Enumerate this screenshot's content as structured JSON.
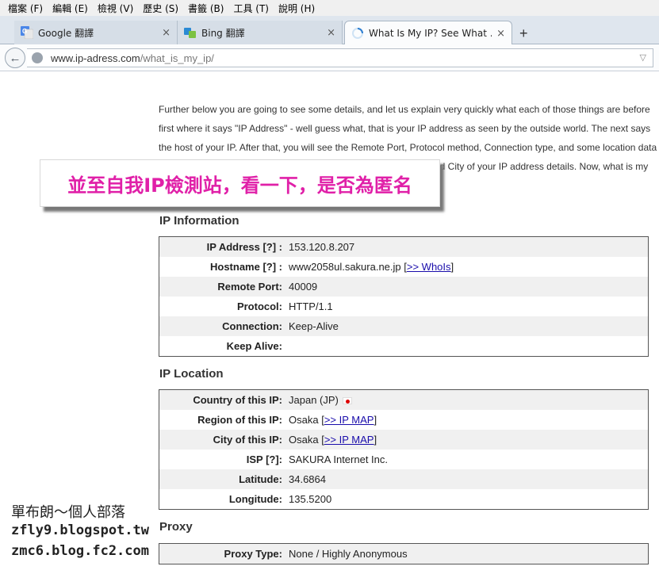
{
  "menu": [
    "檔案 (F)",
    "編輯 (E)",
    "檢視 (V)",
    "歷史 (S)",
    "書籤 (B)",
    "工具 (T)",
    "說明 (H)"
  ],
  "tabs": [
    {
      "title": "Google 翻譯",
      "icon": "google-translate-icon"
    },
    {
      "title": "Bing 翻譯",
      "icon": "bing-translate-icon"
    },
    {
      "title": "What Is My IP? See What ...",
      "icon": "loading-icon",
      "active": true
    }
  ],
  "new_tab_label": "+",
  "tab_close": "×",
  "url": {
    "host": "www.ip-adress.com",
    "path": "/what_is_my_ip/"
  },
  "intro": [
    "Further below you are going to see some details, and let us explain very quickly what each of those things are before",
    "first where it says \"IP Address\" - well guess what, that is your IP address as seen by the outside world. The next says",
    "the host of your IP. After that, you will see the Remote Port, Protocol method, Connection type, and some location data",
    "nd City of your IP address details. Now, what is my"
  ],
  "banner": "並至自我IP檢測站，看一下，是否為匿名",
  "ip_info": {
    "title": "IP Information",
    "rows": [
      {
        "label": "IP Address [?] :",
        "value": "153.120.8.207"
      },
      {
        "label": "Hostname [?] :",
        "value": "www2058ul.sakura.ne.jp",
        "link": ">> WhoIs"
      },
      {
        "label": "Remote Port:",
        "value": "40009"
      },
      {
        "label": "Protocol:",
        "value": "HTTP/1.1"
      },
      {
        "label": "Connection:",
        "value": "Keep-Alive"
      },
      {
        "label": "Keep Alive:",
        "value": ""
      }
    ]
  },
  "ip_location": {
    "title": "IP Location",
    "rows": [
      {
        "label": "Country of this IP:",
        "value": "Japan (JP)",
        "flag": true
      },
      {
        "label": "Region of this IP:",
        "value": "Osaka",
        "link": ">> IP MAP"
      },
      {
        "label": "City of this IP:",
        "value": "Osaka",
        "link": ">> IP MAP"
      },
      {
        "label": "ISP [?]:",
        "value": "SAKURA Internet Inc."
      },
      {
        "label": "Latitude:",
        "value": "34.6864"
      },
      {
        "label": "Longitude:",
        "value": "135.5200"
      }
    ]
  },
  "proxy": {
    "title": "Proxy",
    "rows": [
      {
        "label": "Proxy Type:",
        "value": "None / Highly Anonymous"
      }
    ]
  },
  "watermark": [
    "單布朗～個人部落",
    "zfly9.blogspot.tw",
    "zmc6.blog.fc2.com"
  ]
}
